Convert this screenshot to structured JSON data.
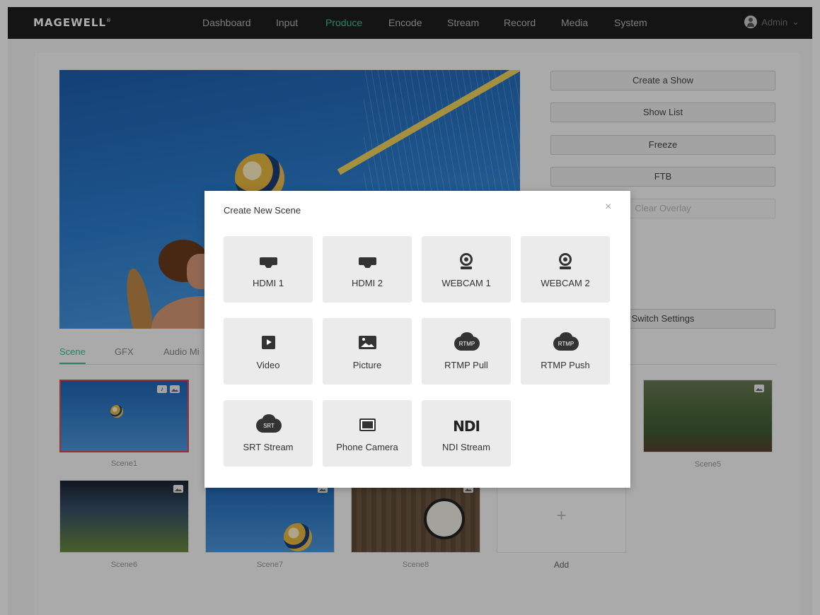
{
  "header": {
    "logo": "MAGEWELL",
    "logo_mark": "®",
    "nav": [
      "Dashboard",
      "Input",
      "Produce",
      "Encode",
      "Stream",
      "Record",
      "Media",
      "System"
    ],
    "active_nav": "Produce",
    "user": "Admin",
    "user_caret": "⌄"
  },
  "actions": {
    "create_show": "Create a Show",
    "show_list": "Show List",
    "freeze": "Freeze",
    "ftb": "FTB",
    "clear_overlay": "Clear Overlay",
    "switch_settings": "Switch Settings"
  },
  "tabs": [
    "Scene",
    "GFX",
    "Audio Mi"
  ],
  "scenes": [
    {
      "label": "Scene1"
    },
    {
      "label": "Scene5"
    },
    {
      "label": "Scene6"
    },
    {
      "label": "Scene7"
    },
    {
      "label": "Scene8"
    },
    {
      "label": "Add"
    }
  ],
  "add_symbol": "+",
  "modal": {
    "title": "Create New Scene",
    "close": "×",
    "sources": [
      {
        "label": "HDMI 1",
        "icon": "hdmi-icon"
      },
      {
        "label": "HDMI 2",
        "icon": "hdmi-icon"
      },
      {
        "label": "WEBCAM 1",
        "icon": "webcam-icon"
      },
      {
        "label": "WEBCAM 2",
        "icon": "webcam-icon"
      },
      {
        "label": "Video",
        "icon": "video-icon"
      },
      {
        "label": "Picture",
        "icon": "picture-icon"
      },
      {
        "label": "RTMP Pull",
        "icon": "rtmp-cloud-icon",
        "icon_text": "RTMP"
      },
      {
        "label": "RTMP Push",
        "icon": "rtmp-cloud-icon",
        "icon_text": "RTMP"
      },
      {
        "label": "SRT Stream",
        "icon": "srt-cloud-icon",
        "icon_text": "SRT"
      },
      {
        "label": "Phone Camera",
        "icon": "phone-camera-icon"
      },
      {
        "label": "NDI Stream",
        "icon": "ndi-icon",
        "icon_text": "NDI"
      }
    ]
  },
  "colors": {
    "accent": "#35c48d",
    "selected_border": "#e04a4a",
    "topbar": "#1e1e1e"
  }
}
